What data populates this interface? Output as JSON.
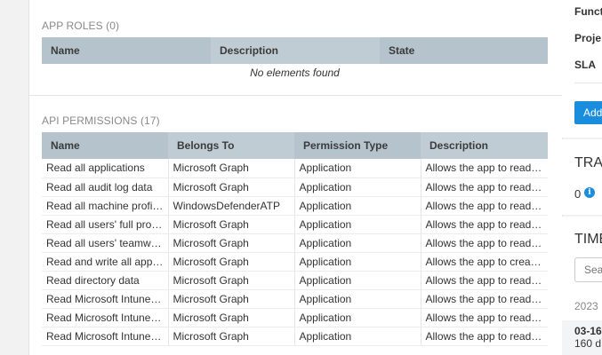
{
  "app_roles": {
    "title": "APP ROLES (0)",
    "columns": [
      "Name",
      "Description",
      "State"
    ],
    "empty_message": "No elements found"
  },
  "api_permissions": {
    "title": "API PERMISSIONS (17)",
    "columns": [
      "Name",
      "Belongs To",
      "Permission Type",
      "Description"
    ],
    "rows": [
      [
        "Read all applications",
        "Microsoft Graph",
        "Application",
        "Allows the app to read…"
      ],
      [
        "Read all audit log data",
        "Microsoft Graph",
        "Application",
        "Allows the app to read…"
      ],
      [
        "Read all machine profi…",
        "WindowsDefenderATP",
        "Application",
        "Allows the app to read…"
      ],
      [
        "Read all users' full pro…",
        "Microsoft Graph",
        "Application",
        "Allows the app to read…"
      ],
      [
        "Read all users' teamw…",
        "Microsoft Graph",
        "Application",
        "Allows the app to read…"
      ],
      [
        "Read and write all app…",
        "Microsoft Graph",
        "Application",
        "Allows the app to crea…"
      ],
      [
        "Read directory data",
        "Microsoft Graph",
        "Application",
        "Allows the app to read…"
      ],
      [
        "Read Microsoft Intune…",
        "Microsoft Graph",
        "Application",
        "Allows the app to read…"
      ],
      [
        "Read Microsoft Intune…",
        "Microsoft Graph",
        "Application",
        "Allows the app to read…"
      ],
      [
        "Read Microsoft Intune…",
        "Microsoft Graph",
        "Application",
        "Allows the app to read…"
      ]
    ]
  },
  "side_panel": {
    "func_label": "Funct",
    "proj_label": "Proje",
    "sla_label": "SLA",
    "add_button": "Add",
    "tracking_title": "TRAC",
    "tracking_count": "0",
    "timeline_title": "TIME",
    "search_placeholder": "Sea",
    "year": "2023",
    "entry_date": "03-16",
    "entry_sub": "160 d"
  },
  "colors": {
    "header_bg": "#b4c3cc",
    "accent": "#1a8ddc"
  }
}
